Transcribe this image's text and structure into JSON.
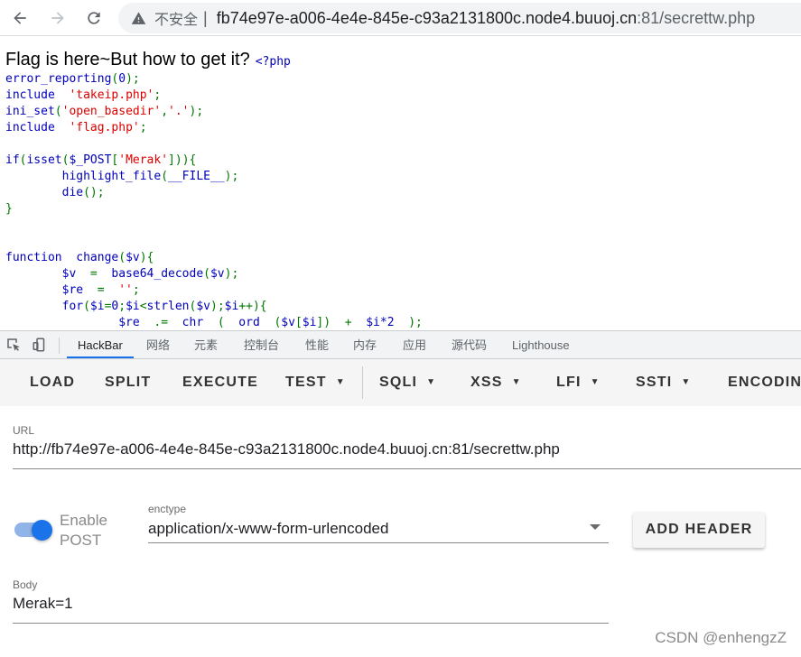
{
  "browser": {
    "security_label": "不安全",
    "separator": "|",
    "url_host": "fb74e97e-a006-4e4e-845e-c93a2131800c.node4.buuoj.cn",
    "url_rest": ":81/secrettw.php",
    "icons": [
      "back-icon",
      "forward-icon",
      "reload-icon",
      "warning-icon"
    ]
  },
  "page": {
    "title": "Flag is here~But how to get it?",
    "php_open": "<?php",
    "code_lines": [
      "error_reporting(0);",
      "include  'takeip.php';",
      "ini_set('open_basedir','.');",
      "include  'flag.php';",
      "",
      "if(isset($_POST['Merak'])){",
      "        highlight_file(__FILE__);",
      "        die();",
      "}",
      "",
      "",
      "function  change($v){",
      "        $v  =  base64_decode($v);",
      "        $re  =  '';",
      "        for($i=0;$i<strlen($v);$i++){",
      "                $re  .=  chr  (  ord  ($v[$i])  +  $i*2  );"
    ],
    "colors": {
      "code_default": "#0000bb",
      "code_string": "#dd0000",
      "code_keyword": "#007700"
    }
  },
  "devtools": {
    "tabs": [
      "HackBar",
      "网络",
      "元素",
      "控制台",
      "性能",
      "内存",
      "应用",
      "源代码",
      "Lighthouse"
    ],
    "active_tab": "HackBar",
    "icons": [
      "inspect-element-icon",
      "device-toolbar-icon"
    ]
  },
  "hackbar": {
    "buttons": [
      {
        "label": "LOAD",
        "dropdown": false
      },
      {
        "label": "SPLIT",
        "dropdown": false
      },
      {
        "label": "EXECUTE",
        "dropdown": false
      },
      {
        "label": "TEST",
        "dropdown": true
      },
      {
        "label": "SQLI",
        "dropdown": true
      },
      {
        "label": "XSS",
        "dropdown": true
      },
      {
        "label": "LFI",
        "dropdown": true
      },
      {
        "label": "SSTI",
        "dropdown": true
      },
      {
        "label": "ENCODING",
        "dropdown": false
      }
    ],
    "url_label": "URL",
    "url_value": "http://fb74e97e-a006-4e4e-845e-c93a2131800c.node4.buuoj.cn:81/secrettw.php",
    "enable_post_label": "Enable POST",
    "enable_post": true,
    "enctype_label": "enctype",
    "enctype_value": "application/x-www-form-urlencoded",
    "add_header_label": "ADD HEADER",
    "body_label": "Body",
    "body_value": "Merak=1",
    "accent_color": "#1a73e8"
  },
  "watermark": "CSDN @enhengzZ"
}
